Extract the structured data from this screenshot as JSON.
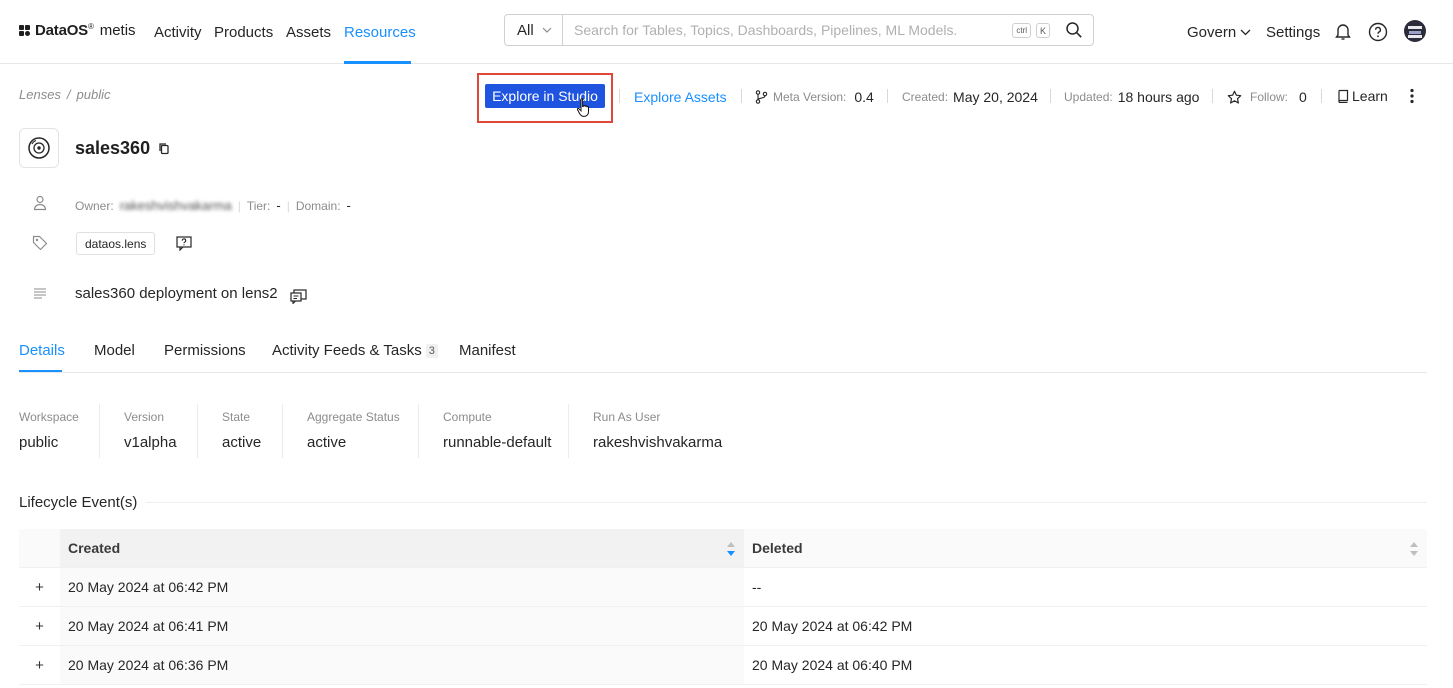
{
  "nav": {
    "brand": "DataOS",
    "brand_mark": "®",
    "brand_sub": "metis",
    "links": [
      "Activity",
      "Products",
      "Assets",
      "Resources"
    ],
    "active_link": "Resources",
    "search": {
      "scope": "All",
      "placeholder": "Search for Tables, Topics, Dashboards, Pipelines, ML Models.",
      "kbd_ctrl": "ctrl",
      "kbd_key": "K"
    },
    "govern": "Govern",
    "settings": "Settings"
  },
  "header": {
    "breadcrumb": [
      "Lenses",
      "public"
    ],
    "explore_studio": "Explore in Studio",
    "explore_assets": "Explore Assets",
    "meta_version_label": "Meta Version:",
    "meta_version": "0.4",
    "created_label": "Created:",
    "created": "May 20, 2024",
    "updated_label": "Updated:",
    "updated": "18 hours ago",
    "follow_label": "Follow:",
    "follow_count": "0",
    "learn": "Learn"
  },
  "entity": {
    "name": "sales360",
    "owner_label": "Owner:",
    "owner": "rakeshvishvakarma",
    "tier_label": "Tier:",
    "tier": "-",
    "domain_label": "Domain:",
    "domain": "-",
    "tag": "dataos.lens",
    "description": "sales360 deployment on lens2"
  },
  "tabs": [
    {
      "label": "Details"
    },
    {
      "label": "Model"
    },
    {
      "label": "Permissions"
    },
    {
      "label": "Activity Feeds & Tasks",
      "count": "3"
    },
    {
      "label": "Manifest"
    }
  ],
  "details": [
    {
      "label": "Workspace",
      "value": "public"
    },
    {
      "label": "Version",
      "value": "v1alpha"
    },
    {
      "label": "State",
      "value": "active"
    },
    {
      "label": "Aggregate Status",
      "value": "active"
    },
    {
      "label": "Compute",
      "value": "runnable-default"
    },
    {
      "label": "Run As User",
      "value": "rakeshvishvakarma"
    }
  ],
  "lifecycle": {
    "title": "Lifecycle Event(s)",
    "columns": [
      "Created",
      "Deleted"
    ],
    "rows": [
      {
        "created": "20 May 2024 at 06:42 PM",
        "deleted": "--"
      },
      {
        "created": "20 May 2024 at 06:41 PM",
        "deleted": "20 May 2024 at 06:42 PM"
      },
      {
        "created": "20 May 2024 at 06:36 PM",
        "deleted": "20 May 2024 at 06:40 PM"
      }
    ]
  },
  "colors": {
    "accent": "#1890ff",
    "primary_button": "#1e54e0",
    "highlight_box": "#e0483c"
  }
}
